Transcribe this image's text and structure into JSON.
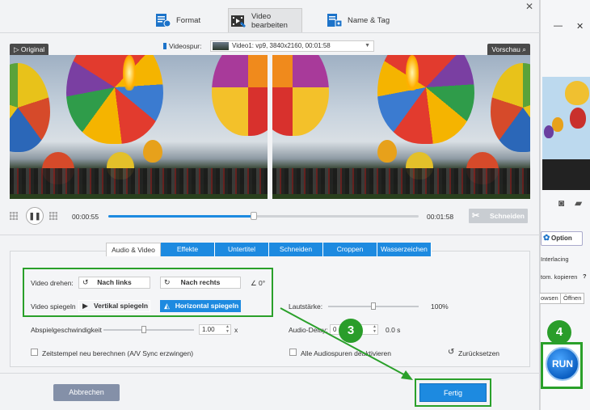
{
  "tabs": [
    {
      "label": "Format",
      "icon": "format-icon"
    },
    {
      "label": "Video bearbeiten",
      "icon": "video-edit-icon",
      "active": true
    },
    {
      "label": "Name & Tag",
      "icon": "name-tag-icon"
    }
  ],
  "video": {
    "original_label": "Original",
    "preview_label": "Vorschau",
    "track_label": "Videospur:",
    "track_value": "Video1: vp9, 3840x2160, 00:01:58"
  },
  "playback": {
    "time_current": "00:00:55",
    "time_total": "00:01:58",
    "progress_fraction": 0.47,
    "cut_label": "Schneiden"
  },
  "subtabs": [
    {
      "label": "Audio & Video",
      "active": true
    },
    {
      "label": "Effekte"
    },
    {
      "label": "Untertitel"
    },
    {
      "label": "Schneiden"
    },
    {
      "label": "Croppen"
    },
    {
      "label": "Wasserzeichen"
    }
  ],
  "rotate": {
    "label": "Video drehen:",
    "left_label": "Nach links",
    "right_label": "Nach rechts",
    "angle": "0°"
  },
  "flip": {
    "label": "Video spiegeln",
    "vertical_label": "Vertikal spiegeln",
    "horizontal_label": "Horizontal spiegeln"
  },
  "speed": {
    "label": "Abspielgeschwindigkeit",
    "value": "1.00",
    "unit": "x",
    "slider_fraction": 0.45
  },
  "volume": {
    "label": "Lautstärke:",
    "value": "100%",
    "slider_fraction": 0.5
  },
  "audio_delay": {
    "label": "Audio-Delay:",
    "value": "0",
    "unit": "0.0 s",
    "slider_fraction": 0.45
  },
  "options": {
    "timestamp_label": "Zeitstempel neu berechnen (A/V Sync erzwingen)",
    "mute_all_label": "Alle Audiospuren deaktivieren",
    "reset_label": "Zurücksetzen"
  },
  "footer": {
    "cancel_label": "Abbrechen",
    "done_label": "Fertig"
  },
  "badges": {
    "step3": "3",
    "step4": "4"
  },
  "background_app": {
    "option_label": "Option",
    "interlacing_label": "Interlacing",
    "copy_label": "tom. kopieren",
    "help": "?",
    "browse_label": "owsen",
    "open_label": "Öffnen",
    "run_label": "RUN",
    "minimize": "—",
    "close": "✕"
  },
  "colors": {
    "accent": "#1d8ae0",
    "highlight": "#2aa02a"
  }
}
